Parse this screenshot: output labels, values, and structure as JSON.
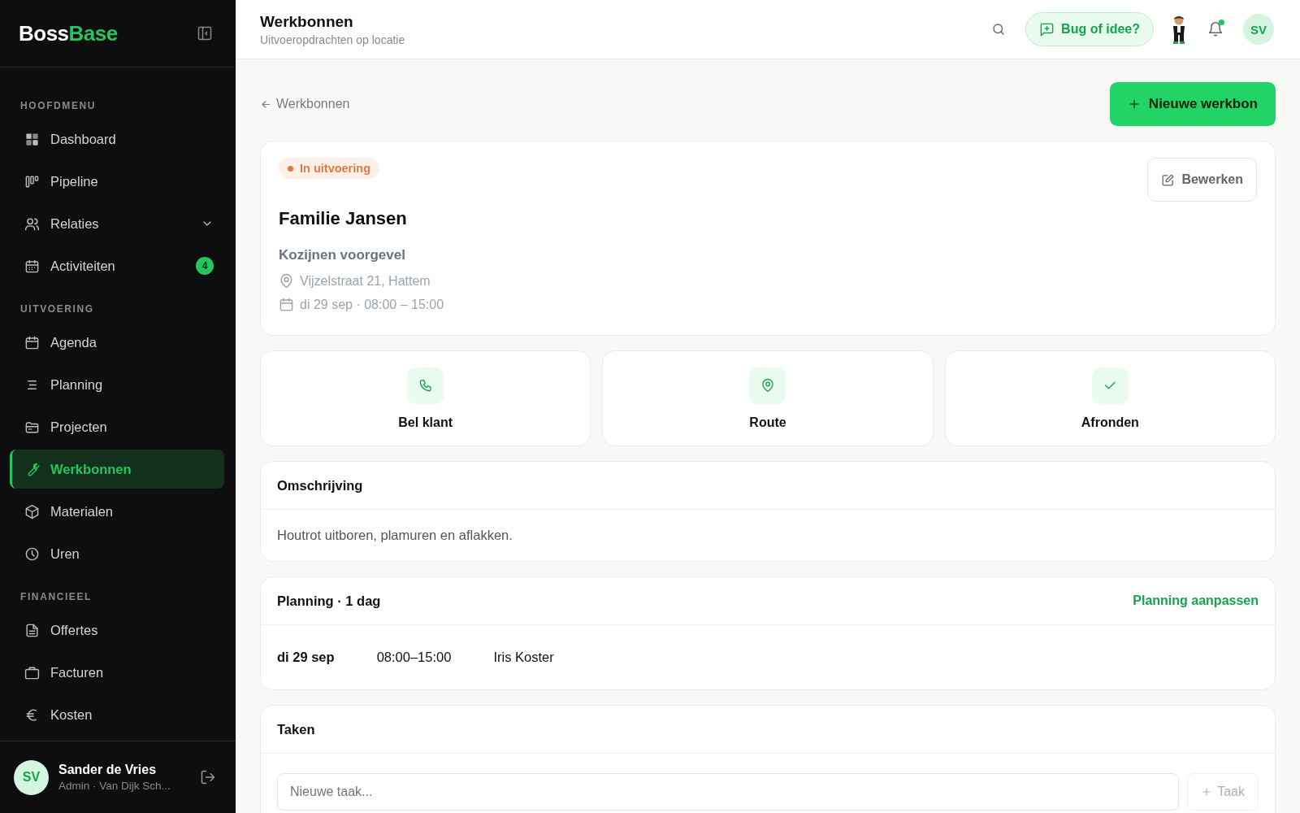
{
  "sidebar": {
    "logo": {
      "part_1": "Boss",
      "part_2": "Base"
    },
    "sections": [
      {
        "title": "HOOFDMENU",
        "items": [
          {
            "label": "Dashboard",
            "selected": false
          },
          {
            "label": "Pipeline",
            "selected": false
          },
          {
            "label": "Relaties",
            "selected": false,
            "expandable": true
          },
          {
            "label": "Activiteiten",
            "selected": false,
            "badge": "4"
          }
        ]
      },
      {
        "title": "UITVOERING",
        "items": [
          {
            "label": "Agenda",
            "selected": false
          },
          {
            "label": "Planning",
            "selected": false
          },
          {
            "label": "Projecten",
            "selected": false
          },
          {
            "label": "Werkbonnen",
            "selected": true
          },
          {
            "label": "Materialen",
            "selected": false
          },
          {
            "label": "Uren",
            "selected": false
          }
        ]
      },
      {
        "title": "FINANCIEEL",
        "items": [
          {
            "label": "Offertes",
            "selected": false
          },
          {
            "label": "Facturen",
            "selected": false
          },
          {
            "label": "Kosten",
            "selected": false
          }
        ]
      }
    ],
    "user": {
      "initials": "SV",
      "name": "Sander de Vries",
      "role": "Admin · Van Dijk Sch..."
    }
  },
  "header": {
    "title": "Werkbonnen",
    "subtitle": "Uitvoeropdrachten op locatie",
    "feedback_button": "Bug of idee?",
    "notifications_unread": true,
    "avatar": "SV"
  },
  "back_link": "Werkbonnen",
  "new_button": "Nieuwe werkbon",
  "workorder": {
    "status": {
      "label": "In uitvoering",
      "kind": "in_progress"
    },
    "client": "Familie Jansen",
    "project": "Kozijnen voorgevel",
    "address": "Vijzelstraat 21, Hattem",
    "date": "di 29 sep · 08:00 – 15:00",
    "edit_button": "Bewerken"
  },
  "actions": [
    {
      "label": "Bel klant"
    },
    {
      "label": "Route"
    },
    {
      "label": "Afronden"
    }
  ],
  "description": {
    "title": "Omschrijving",
    "text": "Houtrot uitboren, plamuren en aflakken."
  },
  "planning": {
    "title": "Planning · 1 dag",
    "link": "Planning aanpassen",
    "rows": [
      {
        "date": "di 29 sep",
        "time": "08:00–15:00",
        "person": "Iris Koster"
      }
    ]
  },
  "tasks": {
    "title": "Taken",
    "placeholder": "Nieuwe taak...",
    "add_button": "Taak"
  }
}
